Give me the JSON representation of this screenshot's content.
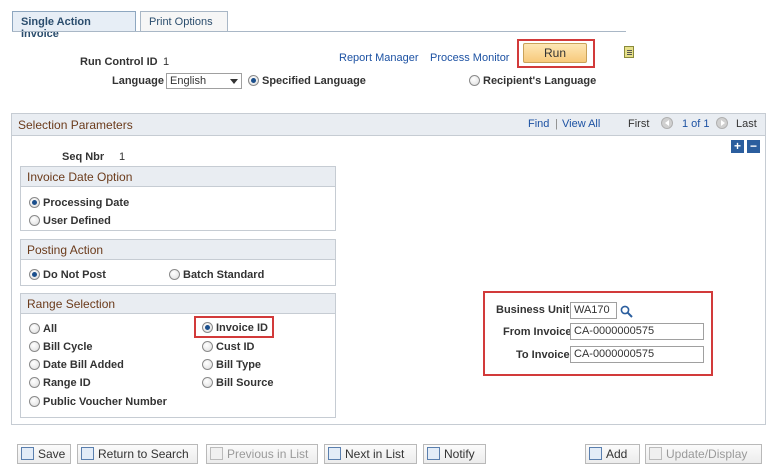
{
  "tabs": [
    {
      "label": "Single Action Invoice"
    },
    {
      "label": "Print Options"
    }
  ],
  "header": {
    "run_control_label": "Run Control ID",
    "run_control_value": "1",
    "report_manager": "Report Manager",
    "process_monitor": "Process Monitor",
    "run_label": "Run",
    "language_label": "Language",
    "language_value": "English",
    "specified_language": "Specified Language",
    "recipients_language": "Recipient's Language"
  },
  "selection": {
    "title": "Selection Parameters",
    "find": "Find",
    "sep": "|",
    "view_all": "View All",
    "first": "First",
    "count": "1 of 1",
    "last": "Last",
    "seq_label": "Seq Nbr",
    "seq_value": "1",
    "plus": "+",
    "minus": "−"
  },
  "invoice_date": {
    "title": "Invoice Date Option",
    "processing_date": "Processing Date",
    "user_defined": "User Defined"
  },
  "posting": {
    "title": "Posting Action",
    "do_not_post": "Do Not Post",
    "batch_standard": "Batch Standard"
  },
  "range": {
    "title": "Range Selection",
    "all": "All",
    "bill_cycle": "Bill Cycle",
    "date_bill_added": "Date Bill Added",
    "range_id": "Range ID",
    "public_voucher": "Public Voucher Number",
    "invoice_id": "Invoice ID",
    "cust_id": "Cust ID",
    "bill_type": "Bill Type",
    "bill_source": "Bill Source"
  },
  "criteria": {
    "business_unit_label": "Business Unit",
    "business_unit_value": "WA170",
    "from_invoice_label": "From Invoice",
    "from_invoice_value": "CA-0000000575",
    "to_invoice_label": "To Invoice",
    "to_invoice_value": "CA-0000000575"
  },
  "toolbar": {
    "save": "Save",
    "return_to_search": "Return to Search",
    "previous_in_list": "Previous in List",
    "next_in_list": "Next in List",
    "notify": "Notify",
    "add": "Add",
    "update_display": "Update/Display"
  },
  "colors": {
    "accent_highlight": "#d23a3a",
    "section_header_text": "#6b3b1b",
    "link": "#1d52a3"
  }
}
